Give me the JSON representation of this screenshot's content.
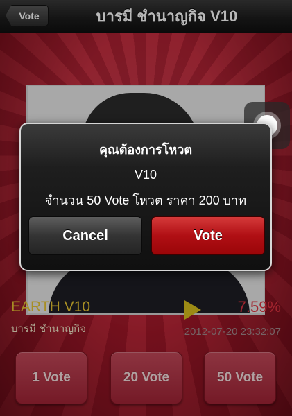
{
  "navbar": {
    "back_label": "Vote",
    "title": "บารมี  ชำนาญกิจ V10"
  },
  "contestant": {
    "name": "EARTH V10",
    "subtitle": "บารมี  ชำนาญกิจ",
    "percent": "7.59%",
    "timestamp": "2012-07-20 23:32:07"
  },
  "vote_buttons": [
    {
      "label": "1 Vote"
    },
    {
      "label": "20 Vote"
    },
    {
      "label": "50 Vote"
    }
  ],
  "alert": {
    "title": "คุณต้องการโหวต",
    "line1": "V10",
    "line2": "จำนวน 50 Vote โหวต ราคา 200 บาท",
    "cancel_label": "Cancel",
    "confirm_label": "Vote"
  },
  "colors": {
    "accent_red": "#b00f14",
    "name_yellow": "#e8c533",
    "percent_red": "#e03340"
  }
}
